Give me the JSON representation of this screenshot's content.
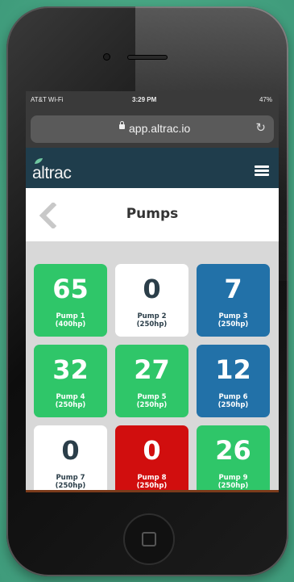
{
  "status_bar": {
    "carrier": "AT&T Wi-Fi",
    "time": "3:29 PM",
    "battery": "47%"
  },
  "browser": {
    "url": "app.altrac.io"
  },
  "app": {
    "logo": "altrac",
    "page_title": "Pumps"
  },
  "pumps": [
    {
      "value": "65",
      "name": "Pump 1",
      "hp": "(400hp)",
      "status": "green"
    },
    {
      "value": "0",
      "name": "Pump 2",
      "hp": "(250hp)",
      "status": "white"
    },
    {
      "value": "7",
      "name": "Pump 3",
      "hp": "(250hp)",
      "status": "blue"
    },
    {
      "value": "32",
      "name": "Pump 4",
      "hp": "(250hp)",
      "status": "green"
    },
    {
      "value": "27",
      "name": "Pump 5",
      "hp": "(250hp)",
      "status": "green"
    },
    {
      "value": "12",
      "name": "Pump 6",
      "hp": "(250hp)",
      "status": "blue"
    },
    {
      "value": "0",
      "name": "Pump 7",
      "hp": "(250hp)",
      "status": "white"
    },
    {
      "value": "0",
      "name": "Pump 8",
      "hp": "(250hp)",
      "status": "red"
    },
    {
      "value": "26",
      "name": "Pump 9",
      "hp": "(250hp)",
      "status": "green"
    }
  ],
  "colors": {
    "green": "#2fc669",
    "blue": "#2271a8",
    "red": "#d10e0e",
    "white": "#ffffff",
    "appbar": "#1f3d4c"
  }
}
